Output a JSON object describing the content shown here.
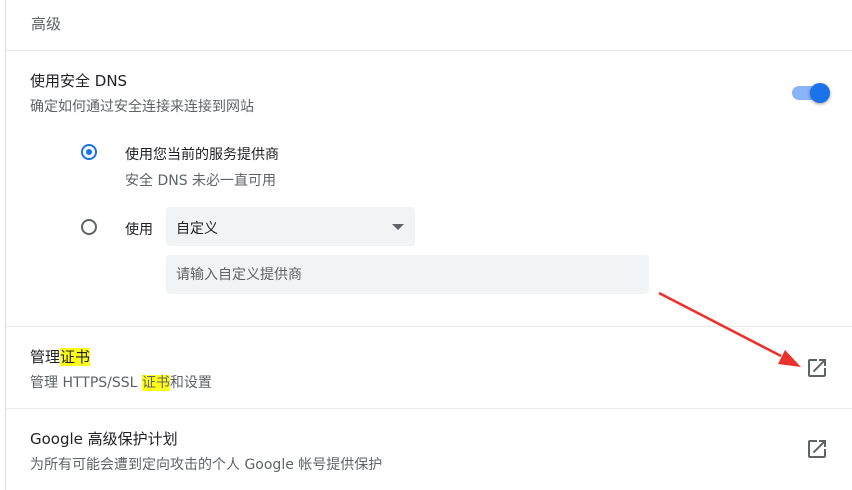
{
  "section": {
    "title": "高级"
  },
  "dns": {
    "title": "使用安全 DNS",
    "subtitle": "确定如何通过安全连接来连接到网站",
    "toggle_on": true,
    "option_current": {
      "label": "使用您当前的服务提供商",
      "sub": "安全 DNS 未必一直可用",
      "selected": true
    },
    "option_custom": {
      "label": "使用",
      "selected": false
    },
    "select_value": "自定义",
    "custom_placeholder": "请输入自定义提供商",
    "accent": "#1a73e8"
  },
  "certs": {
    "title_pre": "管理",
    "title_hl": "证书",
    "sub_pre": "管理 HTTPS/SSL ",
    "sub_hl": "证书",
    "sub_post": "和设置",
    "highlight_color": "#ffff1a",
    "icon": "open-in-new-icon"
  },
  "advanced_protection": {
    "title": "Google 高级保护计划",
    "subtitle": "为所有可能会遭到定向攻击的个人 Google 帐号提供保护",
    "icon": "open-in-new-icon"
  },
  "annotation": {
    "arrow_color": "#e8322b"
  }
}
